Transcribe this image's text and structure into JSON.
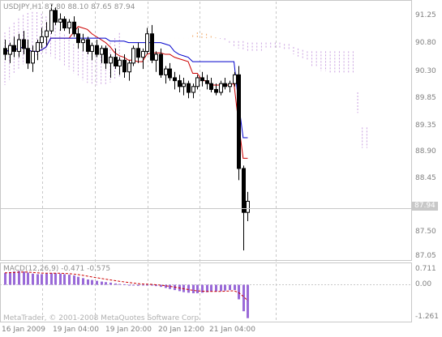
{
  "header": {
    "title": "USDJPY,H1  87.80 88.10 87.65 87.94"
  },
  "oscillator": {
    "title": "MACD(12,26,9)  -0.471  -0.575"
  },
  "footer": {
    "copyright": "MetaTrader, © 2001-2008 MetaQuotes Software Corp."
  },
  "colors": {
    "background": "#ffffff",
    "bull_candle": "#ffffff",
    "bear_candle": "#000000",
    "tenkan": "#cc0000",
    "kijun": "#0000cc",
    "cloud_a": "#c9a0e0",
    "cloud_b": "#f0a868",
    "macd_hist": "#9a6ad8",
    "macd_signal": "#cc0000",
    "grid": "#c8c8c8"
  },
  "price_axis": {
    "labels": [
      "91.25",
      "90.80",
      "90.30",
      "89.85",
      "89.35",
      "88.90",
      "88.45",
      "87.94",
      "87.50",
      "87.05"
    ],
    "current": "87.94"
  },
  "macd_axis": {
    "labels": [
      "0.711",
      "0.00",
      "-1.261"
    ]
  },
  "time_axis": {
    "labels": [
      "16 Jan 2009",
      "19 Jan 04:00",
      "19 Jan 20:00",
      "20 Jan 12:00",
      "21 Jan 04:00"
    ]
  },
  "chart_data": {
    "type": "candlestick",
    "symbol": "USDJPY",
    "timeframe": "H1",
    "last_bar": {
      "open": 87.8,
      "high": 88.1,
      "low": 87.65,
      "close": 87.94
    },
    "ylim": [
      86.95,
      91.35
    ],
    "macd_ylim": [
      -1.33,
      0.75
    ],
    "candles": [
      [
        90.55,
        90.7,
        90.35,
        90.45
      ],
      [
        90.45,
        90.65,
        90.3,
        90.6
      ],
      [
        90.6,
        90.75,
        90.4,
        90.5
      ],
      [
        90.5,
        90.8,
        90.4,
        90.7
      ],
      [
        90.7,
        90.85,
        90.45,
        90.55
      ],
      [
        90.55,
        90.7,
        90.2,
        90.3
      ],
      [
        90.3,
        90.6,
        90.15,
        90.5
      ],
      [
        90.5,
        90.7,
        90.35,
        90.65
      ],
      [
        90.65,
        90.9,
        90.55,
        90.75
      ],
      [
        90.75,
        91.0,
        90.6,
        90.85
      ],
      [
        90.85,
        91.3,
        90.8,
        91.2
      ],
      [
        91.2,
        91.25,
        90.95,
        91.0
      ],
      [
        91.0,
        91.15,
        90.85,
        91.05
      ],
      [
        91.05,
        91.1,
        90.85,
        90.9
      ],
      [
        90.9,
        91.05,
        90.8,
        91.0
      ],
      [
        91.0,
        91.1,
        90.75,
        90.8
      ],
      [
        90.8,
        90.9,
        90.55,
        90.65
      ],
      [
        90.65,
        90.8,
        90.5,
        90.7
      ],
      [
        90.7,
        90.75,
        90.45,
        90.5
      ],
      [
        90.5,
        90.65,
        90.35,
        90.6
      ],
      [
        90.6,
        90.7,
        90.4,
        90.45
      ],
      [
        90.45,
        90.6,
        90.3,
        90.55
      ],
      [
        90.55,
        90.6,
        90.2,
        90.3
      ],
      [
        90.3,
        90.45,
        90.05,
        90.4
      ],
      [
        90.4,
        90.55,
        90.2,
        90.25
      ],
      [
        90.25,
        90.4,
        90.1,
        90.35
      ],
      [
        90.35,
        90.45,
        90.05,
        90.15
      ],
      [
        90.15,
        90.35,
        90.0,
        90.3
      ],
      [
        90.3,
        90.6,
        90.25,
        90.55
      ],
      [
        90.55,
        90.65,
        90.3,
        90.4
      ],
      [
        90.4,
        90.55,
        90.2,
        90.5
      ],
      [
        90.5,
        90.9,
        90.45,
        90.8
      ],
      [
        90.8,
        90.95,
        90.3,
        90.35
      ],
      [
        90.35,
        90.5,
        90.15,
        90.45
      ],
      [
        90.45,
        90.55,
        90.05,
        90.1
      ],
      [
        90.1,
        90.25,
        89.95,
        90.2
      ],
      [
        90.2,
        90.3,
        90.0,
        90.05
      ],
      [
        90.05,
        90.15,
        89.85,
        90.0
      ],
      [
        90.0,
        90.1,
        89.8,
        89.9
      ],
      [
        89.9,
        90.05,
        89.75,
        89.95
      ],
      [
        89.95,
        90.0,
        89.7,
        89.8
      ],
      [
        89.8,
        89.95,
        89.7,
        89.9
      ],
      [
        89.9,
        90.1,
        89.85,
        90.05
      ],
      [
        90.05,
        90.15,
        89.9,
        90.0
      ],
      [
        90.0,
        90.1,
        89.85,
        89.95
      ],
      [
        89.95,
        90.05,
        89.8,
        89.85
      ],
      [
        89.85,
        89.95,
        89.75,
        89.8
      ],
      [
        89.8,
        90.0,
        89.75,
        89.95
      ],
      [
        89.95,
        90.05,
        89.85,
        89.9
      ],
      [
        89.9,
        90.0,
        89.8,
        89.95
      ],
      [
        89.95,
        90.15,
        89.9,
        90.1
      ],
      [
        90.1,
        90.25,
        88.3,
        88.5
      ],
      [
        88.5,
        88.55,
        87.1,
        87.75
      ],
      [
        87.75,
        88.1,
        87.6,
        87.94
      ]
    ],
    "macd_histogram": [
      0.45,
      0.48,
      0.5,
      0.52,
      0.5,
      0.46,
      0.42,
      0.4,
      0.4,
      0.42,
      0.44,
      0.44,
      0.42,
      0.4,
      0.38,
      0.35,
      0.3,
      0.25,
      0.2,
      0.18,
      0.15,
      0.12,
      0.1,
      0.08,
      0.05,
      0.03,
      0.02,
      0.0,
      -0.02,
      -0.04,
      -0.03,
      0.0,
      -0.02,
      -0.05,
      -0.08,
      -0.12,
      -0.16,
      -0.2,
      -0.24,
      -0.28,
      -0.3,
      -0.32,
      -0.32,
      -0.3,
      -0.28,
      -0.26,
      -0.25,
      -0.24,
      -0.22,
      -0.2,
      -0.2,
      -0.55,
      -1.0,
      -1.26
    ]
  }
}
